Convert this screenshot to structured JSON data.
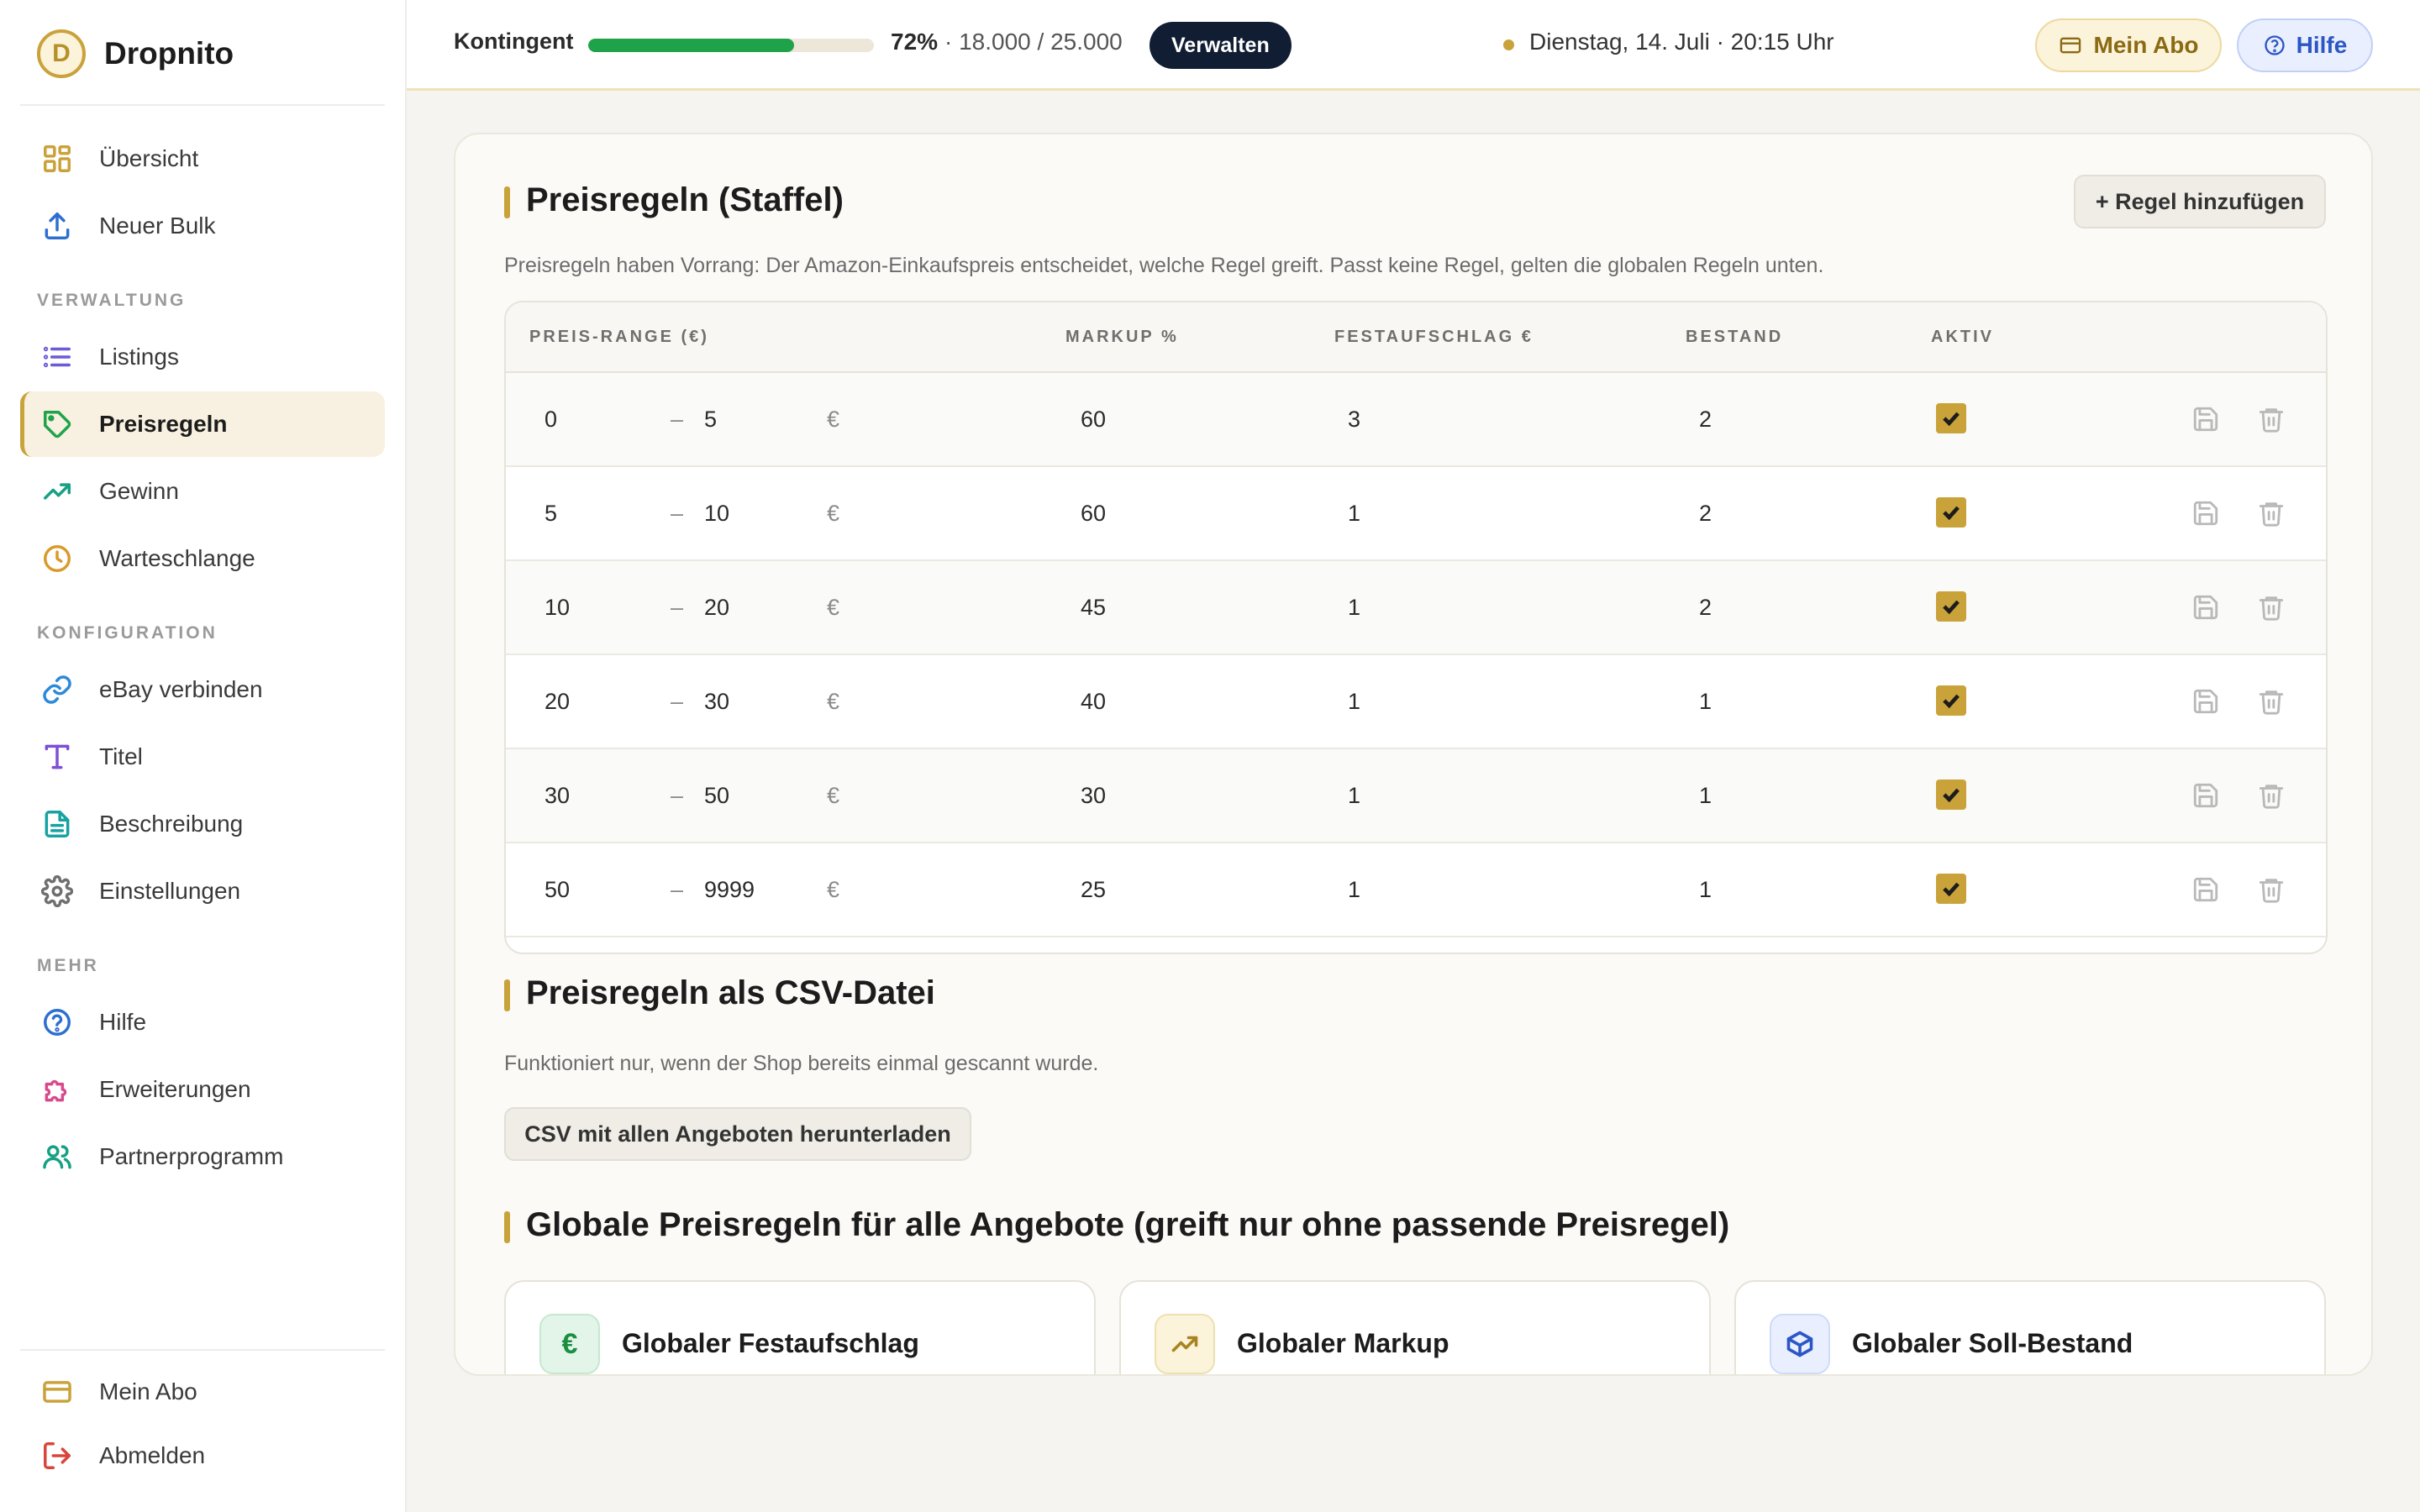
{
  "brand": {
    "name": "Dropnito",
    "logo_letter": "D"
  },
  "sidebar": {
    "top_items": [
      {
        "label": "Übersicht",
        "icon": "grid-icon"
      },
      {
        "label": "Neuer Bulk",
        "icon": "upload-icon"
      }
    ],
    "sections": [
      {
        "title": "VERWALTUNG",
        "items": [
          {
            "label": "Listings",
            "icon": "list-icon"
          },
          {
            "label": "Preisregeln",
            "icon": "tag-icon",
            "active": true
          },
          {
            "label": "Gewinn",
            "icon": "trend-icon"
          },
          {
            "label": "Warteschlange",
            "icon": "clock-icon"
          }
        ]
      },
      {
        "title": "KONFIGURATION",
        "items": [
          {
            "label": "eBay verbinden",
            "icon": "link-icon"
          },
          {
            "label": "Titel",
            "icon": "text-icon"
          },
          {
            "label": "Beschreibung",
            "icon": "document-icon"
          },
          {
            "label": "Einstellungen",
            "icon": "gear-icon"
          }
        ]
      },
      {
        "title": "MEHR",
        "items": [
          {
            "label": "Hilfe",
            "icon": "help-icon"
          },
          {
            "label": "Erweiterungen",
            "icon": "puzzle-icon"
          },
          {
            "label": "Partnerprogramm",
            "icon": "users-icon"
          }
        ]
      }
    ],
    "bottom_items": [
      {
        "label": "Mein Abo",
        "icon": "card-icon"
      },
      {
        "label": "Abmelden",
        "icon": "logout-icon"
      }
    ]
  },
  "header": {
    "quota_label": "Kontingent",
    "quota_percent": 72,
    "quota_percent_text": "72%",
    "quota_count_text": "· 18.000 / 25.000",
    "manage_button": "Verwalten",
    "datetime": "Dienstag, 14. Juli · 20:15 Uhr",
    "abo_button": "Mein Abo",
    "help_button": "Hilfe"
  },
  "pricing_rules": {
    "title": "Preisregeln (Staffel)",
    "add_button": "+ Regel hinzufügen",
    "description": "Preisregeln haben Vorrang: Der Amazon-Einkaufspreis entscheidet, welche Regel greift. Passt keine Regel, gelten die globalen Regeln unten.",
    "columns": [
      "PREIS-RANGE (€)",
      "MARKUP %",
      "FESTAUFSCHLAG €",
      "BESTAND",
      "AKTIV"
    ],
    "range_separator": "–",
    "currency": "€",
    "rows": [
      {
        "from": "0",
        "to": "5",
        "markup": "60",
        "surcharge": "3",
        "stock": "2",
        "active": true
      },
      {
        "from": "5",
        "to": "10",
        "markup": "60",
        "surcharge": "1",
        "stock": "2",
        "active": true
      },
      {
        "from": "10",
        "to": "20",
        "markup": "45",
        "surcharge": "1",
        "stock": "2",
        "active": true
      },
      {
        "from": "20",
        "to": "30",
        "markup": "40",
        "surcharge": "1",
        "stock": "1",
        "active": true
      },
      {
        "from": "30",
        "to": "50",
        "markup": "30",
        "surcharge": "1",
        "stock": "1",
        "active": true
      },
      {
        "from": "50",
        "to": "9999",
        "markup": "25",
        "surcharge": "1",
        "stock": "1",
        "active": true
      }
    ]
  },
  "csv": {
    "title": "Preisregeln als CSV-Datei",
    "description": "Funktioniert nur, wenn der Shop bereits einmal gescannt wurde.",
    "download_button": "CSV mit allen Angeboten herunterladen"
  },
  "global_rules": {
    "title": "Globale Preisregeln für alle Angebote (greift nur ohne passende Preisregel)",
    "cards": [
      {
        "title": "Globaler Festaufschlag",
        "icon": "euro-icon",
        "glyph": "€"
      },
      {
        "title": "Globaler Markup",
        "icon": "trend-icon"
      },
      {
        "title": "Globaler Soll-Bestand",
        "icon": "box-icon"
      }
    ]
  },
  "colors": {
    "accent": "#c9a23a",
    "progress": "#1fa34a",
    "dark_button": "#111d33",
    "help_blue": "#2d56c5"
  }
}
